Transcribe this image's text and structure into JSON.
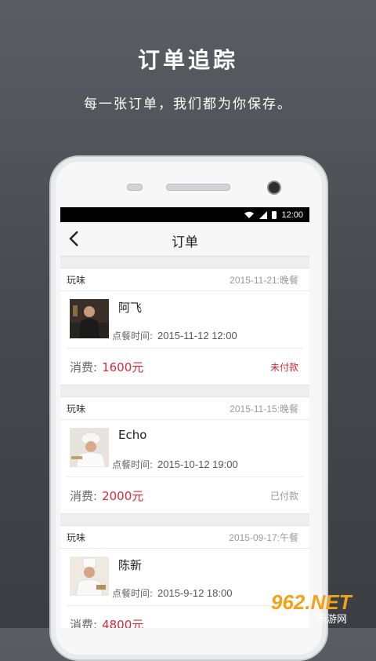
{
  "headline": "订单追踪",
  "subline": "每一张订单，我们都为你保存。",
  "status_bar": {
    "time": "12:00"
  },
  "nav": {
    "title": "订单"
  },
  "labels": {
    "time_prefix": "点餐时间:",
    "cost_prefix": "消费:"
  },
  "orders": [
    {
      "shop": "玩味",
      "date": "2015-11-21:晚餐",
      "chef": "阿飞",
      "time": "2015-11-12  12:00",
      "amount": "1600元",
      "status": "未付款"
    },
    {
      "shop": "玩味",
      "date": "2015-11-15:晚餐",
      "chef": "Echo",
      "time": "2015-10-12  19:00",
      "amount": "2000元",
      "status": "已付款"
    },
    {
      "shop": "玩味",
      "date": "2015-09-17:午餐",
      "chef": "陈新",
      "time": "2015-9-12  18:00",
      "amount": "4800元",
      "status": ""
    }
  ],
  "watermark": {
    "logo": "962.NET",
    "sub": "乐游网"
  },
  "colors": {
    "accent_red": "#d32a3a",
    "paid_gray": "#9a9a9a",
    "background": "#4a4c51"
  }
}
